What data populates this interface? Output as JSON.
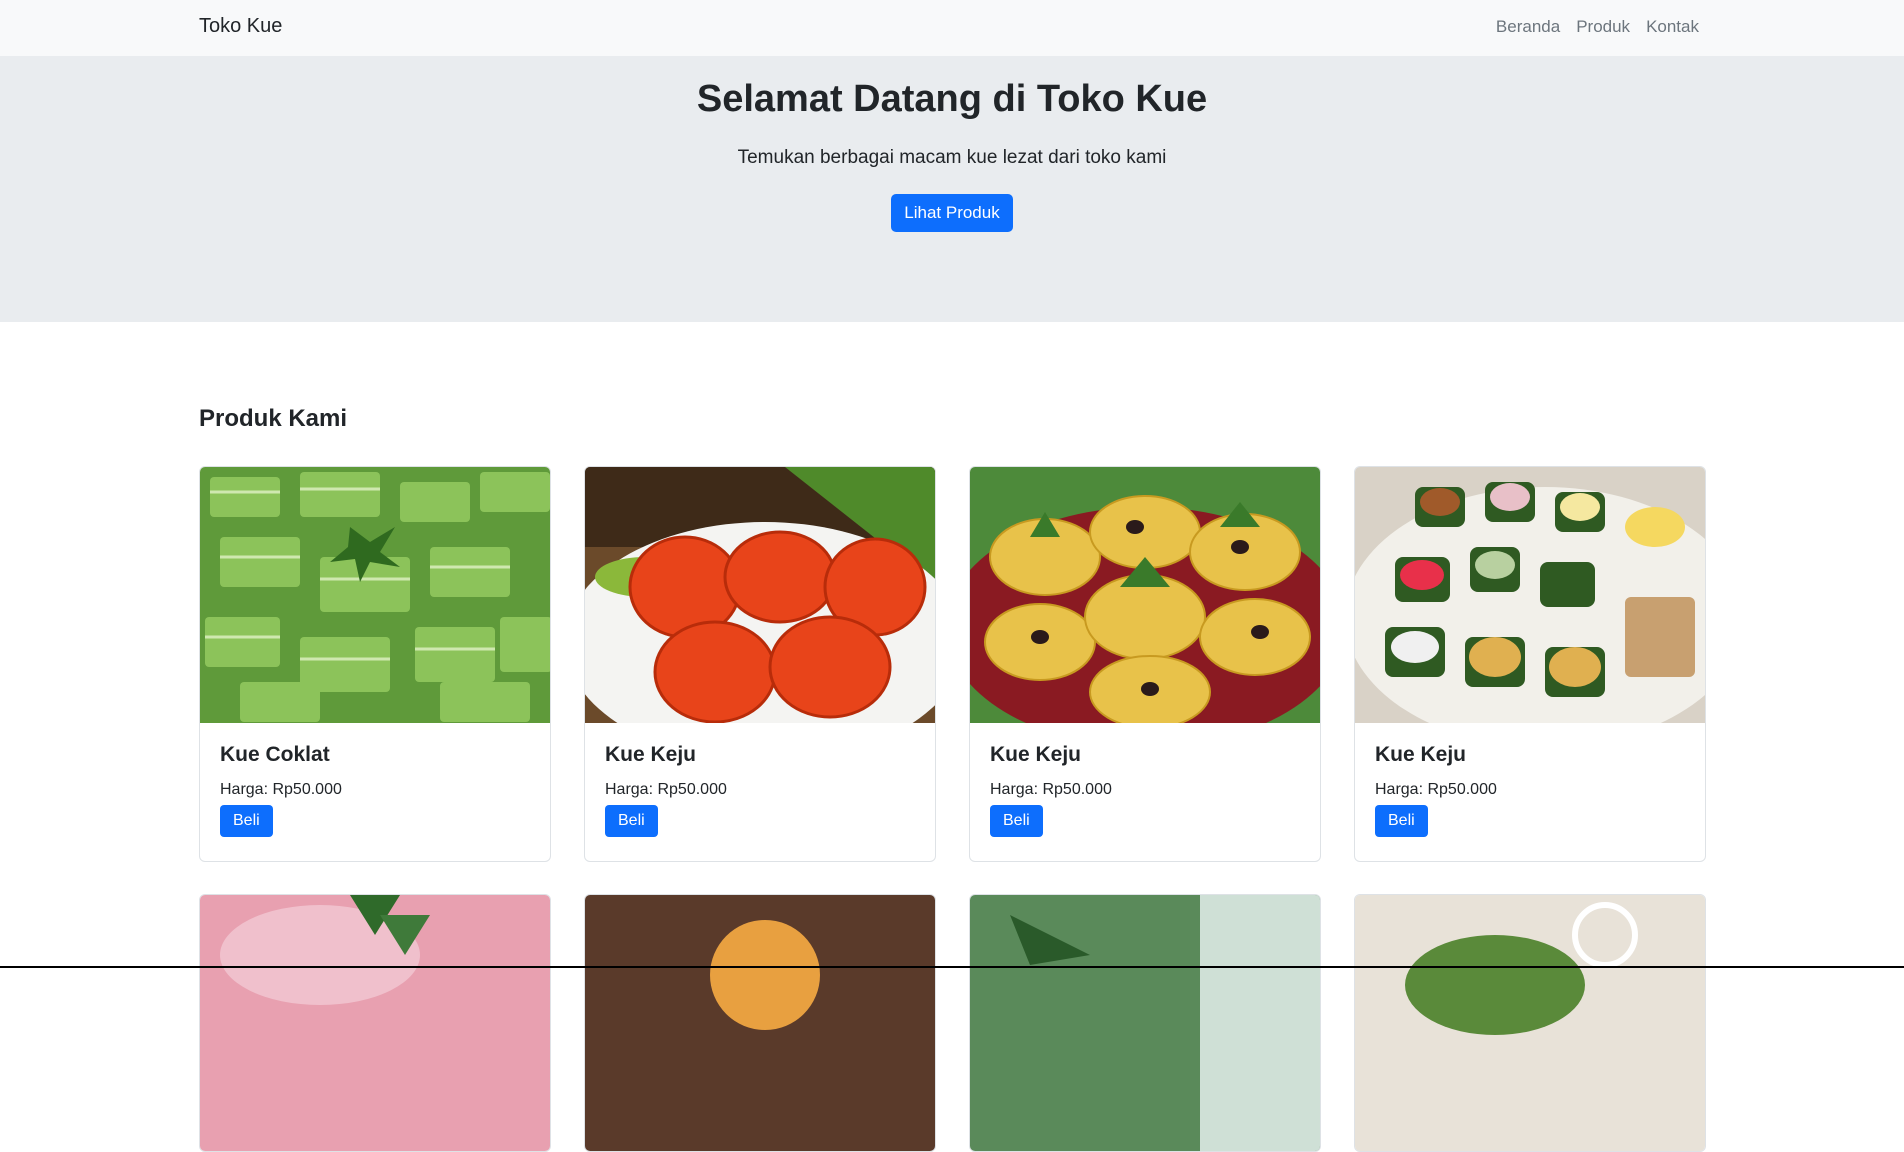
{
  "navbar": {
    "brand": "Toko Kue",
    "links": [
      "Beranda",
      "Produk",
      "Kontak"
    ]
  },
  "hero": {
    "title": "Selamat Datang di Toko Kue",
    "subtitle": "Temukan berbagai macam kue lezat dari toko kami",
    "button": "Lihat Produk"
  },
  "products_section": {
    "title": "Produk Kami",
    "items": [
      {
        "name": "Kue Coklat",
        "price": "Harga: Rp50.000",
        "button": "Beli",
        "image": "green-layer-cake"
      },
      {
        "name": "Kue Keju",
        "price": "Harga: Rp50.000",
        "button": "Beli",
        "image": "red-turtle-cake"
      },
      {
        "name": "Kue Keju",
        "price": "Harga: Rp50.000",
        "button": "Beli",
        "image": "yellow-kue-lumpur"
      },
      {
        "name": "Kue Keju",
        "price": "Harga: Rp50.000",
        "button": "Beli",
        "image": "assorted-kue"
      }
    ],
    "more_images": [
      "pink-kue",
      "sesame-ball",
      "green-leaf-kue",
      "green-kue-tray"
    ]
  },
  "colors": {
    "primary": "#0d6efd",
    "navbar_bg": "#f8f9fa",
    "hero_bg": "#e9ecef"
  }
}
